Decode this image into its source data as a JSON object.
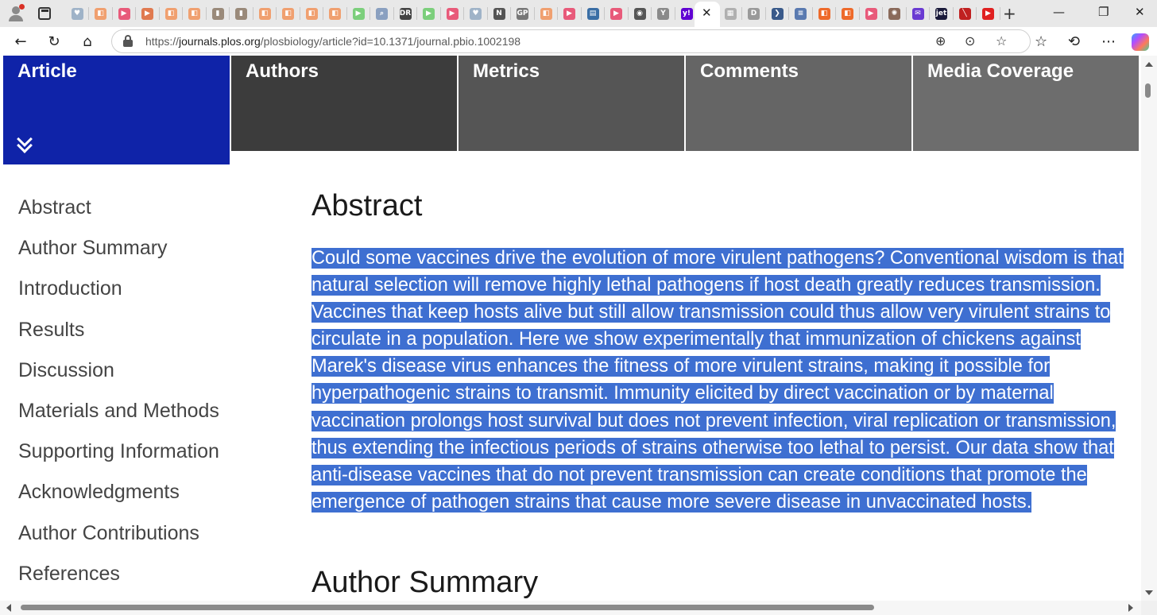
{
  "browser": {
    "url_prefix": "https://",
    "url_host": "journals.plos.org",
    "url_path": "/plosbiology/article?id=10.1371/journal.pbio.1002198",
    "favicon_tabs": [
      {
        "icon": "heart-pulse-icon",
        "color": "#9fb3c8",
        "glyph": "♥"
      },
      {
        "icon": "bookmark-icon",
        "color": "#f0a070",
        "glyph": "◧"
      },
      {
        "icon": "youtube-icon",
        "color": "#e85a7a",
        "glyph": "▶"
      },
      {
        "icon": "play-icon",
        "color": "#e07a50",
        "glyph": "▶"
      },
      {
        "icon": "bookmark-icon",
        "color": "#f0a070",
        "glyph": "◧"
      },
      {
        "icon": "bookmark-icon",
        "color": "#f0a070",
        "glyph": "◧"
      },
      {
        "icon": "figure-icon",
        "color": "#9a8a7a",
        "glyph": "▮"
      },
      {
        "icon": "figure-icon",
        "color": "#9a8a7a",
        "glyph": "▮"
      },
      {
        "icon": "bookmark-icon",
        "color": "#f0a070",
        "glyph": "◧"
      },
      {
        "icon": "bookmark-icon",
        "color": "#f0a070",
        "glyph": "◧"
      },
      {
        "icon": "bookmark-icon",
        "color": "#f0a070",
        "glyph": "◧"
      },
      {
        "icon": "bookmark-icon",
        "color": "#f0a070",
        "glyph": "◧"
      },
      {
        "icon": "play-green-icon",
        "color": "#7ccf7c",
        "glyph": "▶"
      },
      {
        "icon": "search-icon",
        "color": "#8aa0c0",
        "glyph": "⌕"
      },
      {
        "icon": "dr-icon",
        "color": "#444444",
        "glyph": "DR"
      },
      {
        "icon": "play-green-icon",
        "color": "#7ccf7c",
        "glyph": "▶"
      },
      {
        "icon": "youtube-icon",
        "color": "#e85a7a",
        "glyph": "▶"
      },
      {
        "icon": "heart-pulse-icon",
        "color": "#9fb3c8",
        "glyph": "♥"
      },
      {
        "icon": "news-icon",
        "color": "#555555",
        "glyph": "N"
      },
      {
        "icon": "gp-icon",
        "color": "#777777",
        "glyph": "GP"
      },
      {
        "icon": "bookmark-icon",
        "color": "#f0a070",
        "glyph": "◧"
      },
      {
        "icon": "youtube-icon",
        "color": "#e85a7a",
        "glyph": "▶"
      },
      {
        "icon": "document-icon",
        "color": "#3a6ea5",
        "glyph": "▤"
      },
      {
        "icon": "youtube-icon",
        "color": "#e85a7a",
        "glyph": "▶"
      },
      {
        "icon": "circle-icon",
        "color": "#555555",
        "glyph": "◉"
      },
      {
        "icon": "y-icon",
        "color": "#8a8a8a",
        "glyph": "Y"
      },
      {
        "icon": "yahoo-icon",
        "color": "#6001d2",
        "glyph": "y!"
      }
    ],
    "favicon_tabs_right": [
      {
        "icon": "book-icon",
        "color": "#b0b0b0",
        "glyph": "▦"
      },
      {
        "icon": "d-icon",
        "color": "#9a9a9a",
        "glyph": "D"
      },
      {
        "icon": "arrow-icon",
        "color": "#3a5a8a",
        "glyph": "❯"
      },
      {
        "icon": "list-icon",
        "color": "#5a7ab0",
        "glyph": "≡"
      },
      {
        "icon": "bookmark-icon",
        "color": "#ee6a2a",
        "glyph": "◧"
      },
      {
        "icon": "bookmark-icon",
        "color": "#ee6a2a",
        "glyph": "◧"
      },
      {
        "icon": "youtube-icon",
        "color": "#e85a7a",
        "glyph": "▶"
      },
      {
        "icon": "seal-icon",
        "color": "#8a6a5a",
        "glyph": "✺"
      },
      {
        "icon": "mail-icon",
        "color": "#6a3ad2",
        "glyph": "✉"
      },
      {
        "icon": "jet-icon",
        "color": "#1a1a3a",
        "glyph": "jet"
      },
      {
        "icon": "slash-icon",
        "color": "#c02020",
        "glyph": "╲"
      },
      {
        "icon": "youtube-red-icon",
        "color": "#e02020",
        "glyph": "▶"
      }
    ]
  },
  "article_nav": {
    "tabs": [
      {
        "label": "Article",
        "active": true
      },
      {
        "label": "Authors",
        "active": false
      },
      {
        "label": "Metrics",
        "active": false
      },
      {
        "label": "Comments",
        "active": false
      },
      {
        "label": "Media Coverage",
        "active": false
      }
    ],
    "active_color": "#0f23a8"
  },
  "sidebar": {
    "items": [
      {
        "label": "Abstract"
      },
      {
        "label": "Author Summary"
      },
      {
        "label": "Introduction"
      },
      {
        "label": "Results"
      },
      {
        "label": "Discussion"
      },
      {
        "label": "Materials and Methods"
      },
      {
        "label": "Supporting Information"
      },
      {
        "label": "Acknowledgments"
      },
      {
        "label": "Author Contributions"
      },
      {
        "label": "References"
      }
    ]
  },
  "main": {
    "abstract_heading": "Abstract",
    "abstract_text": "Could some vaccines drive the evolution of more virulent pathogens? Conventional wisdom is that natural selection will remove highly lethal pathogens if host death greatly reduces transmission. Vaccines that keep hosts alive but still allow transmission could thus allow very virulent strains to circulate in a population. Here we show experimentally that immunization of chickens against Marek's disease virus enhances the fitness of more virulent strains, making it possible for hyperpathogenic strains to transmit. Immunity elicited by direct vaccination or by maternal vaccination prolongs host survival but does not prevent infection, viral replication or transmission, thus extending the infectious periods of strains otherwise too lethal to persist. Our data show that anti-disease vaccines that do not prevent transmission can create conditions that promote the emergence of pathogen strains that cause more severe disease in unvaccinated hosts.",
    "selection_color": "#3e6fd1",
    "summary_heading": "Author Summary"
  }
}
